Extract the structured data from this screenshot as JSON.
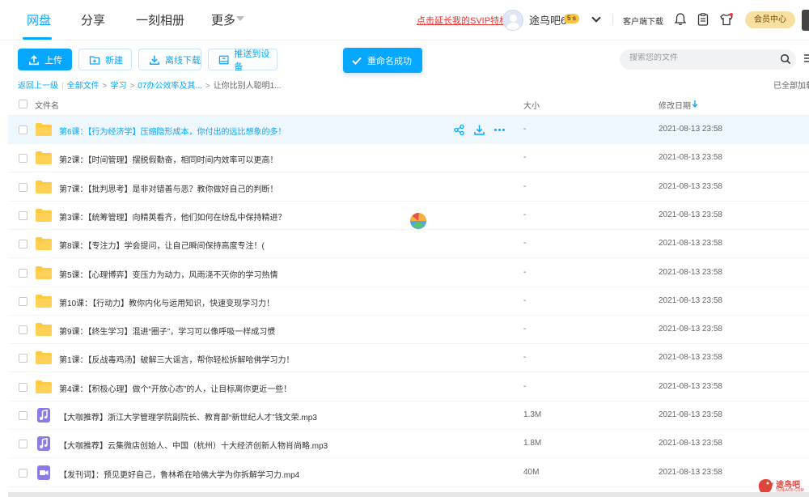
{
  "nav": {
    "tabs": [
      {
        "label": "网盘",
        "active": true
      },
      {
        "label": "分享",
        "active": false
      },
      {
        "label": "一刻相册",
        "active": false
      },
      {
        "label": "更多",
        "active": false
      }
    ],
    "svip_link": "点击延长我的SVIP特权",
    "username": "途鸟吧6",
    "vip_badge": "5 s",
    "client_download": "客户端下载",
    "vip_center": "会员中心"
  },
  "toolbar": {
    "upload": "上传",
    "new": "新建",
    "offline_download": "离线下载",
    "push_to_device": "推送到设备",
    "toast": "重命名成功",
    "search_placeholder": "搜索您的文件"
  },
  "breadcrumb": {
    "back": "返回上一级",
    "items": [
      "全部文件",
      "学习",
      "07办公效率及其...",
      "让你比别人聪明1..."
    ],
    "loaded_all": "已全部加载"
  },
  "table": {
    "headers": {
      "name": "文件名",
      "size": "大小",
      "date": "修改日期"
    },
    "rows": [
      {
        "name": "第6课：【行为经济学】压缩隐形成本，你付出的远比想象的多！",
        "type": "folder",
        "size": "-",
        "date": "2021-08-13 23:58",
        "highlighted": true
      },
      {
        "name": "第2课：【时间管理】摆脱假勤奋，相同时间内效率可以更高！",
        "type": "folder",
        "size": "-",
        "date": "2021-08-13 23:58"
      },
      {
        "name": "第7课：【批判思考】是非对错善与恶？教你做好自己的判断！",
        "type": "folder",
        "size": "-",
        "date": "2021-08-13 23:58"
      },
      {
        "name": "第3课：【统筹管理】向精英看齐，他们如何在纷乱中保持精进？",
        "type": "folder",
        "size": "-",
        "date": "2021-08-13 23:58"
      },
      {
        "name": "第8课：【专注力】学会提问，让自己瞬间保持高度专注！(",
        "type": "folder",
        "size": "-",
        "date": "2021-08-13 23:58"
      },
      {
        "name": "第5课：【心理博弈】变压力为动力，风雨浇不灭你的学习热情",
        "type": "folder",
        "size": "-",
        "date": "2021-08-13 23:58"
      },
      {
        "name": "第10课：【行动力】教你内化与运用知识，快速变现学习力！",
        "type": "folder",
        "size": "-",
        "date": "2021-08-13 23:58"
      },
      {
        "name": "第9课：【终生学习】混进“圈子”，学习可以像呼吸一样成习惯",
        "type": "folder",
        "size": "-",
        "date": "2021-08-13 23:58"
      },
      {
        "name": "第1课：【反战毒鸡汤】破解三大谣言，帮你轻松拆解哈佛学习力！",
        "type": "folder",
        "size": "-",
        "date": "2021-08-13 23:58"
      },
      {
        "name": "第4课：【积极心理】做个“开放心态”的人，让目标离你更近一些！",
        "type": "folder",
        "size": "-",
        "date": "2021-08-13 23:58"
      },
      {
        "name": "【大咖推荐】浙江大学管理学院副院长、教育部“新世纪人才”钱文荣.mp3",
        "type": "audio",
        "size": "1.3M",
        "date": "2021-08-13 23:58"
      },
      {
        "name": "【大咖推荐】云集微店创始人、中国（杭州）十大经济创新人物肖尚略.mp3",
        "type": "audio",
        "size": "1.8M",
        "date": "2021-08-13 23:58"
      },
      {
        "name": "【发刊词】：预见更好自己，鲁林希在哈佛大学为你拆解学习力.mp4",
        "type": "video",
        "size": "40M",
        "date": "2021-08-13 23:58"
      }
    ]
  },
  "watermark": {
    "text": "途鸟吧",
    "sub": "TUNIAO8.COM"
  },
  "colors": {
    "accent": "#06a7ff",
    "folder": "#ffc940",
    "media": "#8c7ae6",
    "svip_link": "#e33333"
  }
}
